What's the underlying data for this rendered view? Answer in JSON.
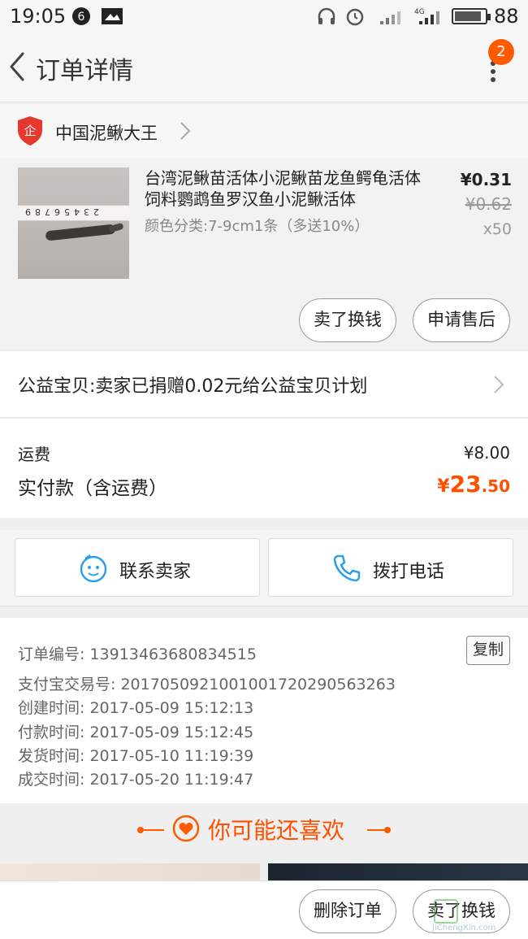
{
  "status_bar": {
    "time": "19:05",
    "battery": "88",
    "battery_level": 0.88,
    "network": "4G"
  },
  "nav": {
    "title": "订单详情",
    "badge_count": "2"
  },
  "shop": {
    "name": "中国泥鳅大王",
    "icon_char": "企",
    "icon_color": "#e5392d"
  },
  "product": {
    "title": "台湾泥鳅苗活体小泥鳅苗龙鱼鳄龟活体饲料鹦鹉鱼罗汉鱼小泥鳅活体",
    "spec": "颜色分类:7-9cm1条（多送10%）",
    "price": "¥0.31",
    "original_price": "¥0.62",
    "quantity": "x50",
    "ruler_numbers": "23456789",
    "actions": {
      "sell": "卖了换钱",
      "after_sale": "申请售后"
    }
  },
  "charity": {
    "text": "公益宝贝:卖家已捐赠0.02元给公益宝贝计划"
  },
  "totals": {
    "shipping_label": "运费",
    "shipping_value": "¥8.00",
    "paid_label": "实付款（含运费）",
    "paid_currency": "¥",
    "paid_int": "23",
    "paid_dec": ".50",
    "accent": "#ff5000"
  },
  "contact": {
    "seller": "联系卖家",
    "phone": "拨打电话",
    "icon_color": "#2d9fe8"
  },
  "order_info": {
    "copy": "复制",
    "rows": [
      "订单编号: 13913463680834515",
      "支付宝交易号: 2017050921001001720290563263",
      "创建时间: 2017-05-09 15:12:13",
      "付款时间: 2017-05-09 15:12:45",
      "发货时间: 2017-05-10 11:19:39",
      "成交时间: 2017-05-20 11:19:47"
    ]
  },
  "recommend": {
    "title": "你可能还喜欢"
  },
  "bottom": {
    "delete": "删除订单",
    "sell": "卖了换钱"
  },
  "watermark": {
    "url": "JiChengXin.com"
  }
}
